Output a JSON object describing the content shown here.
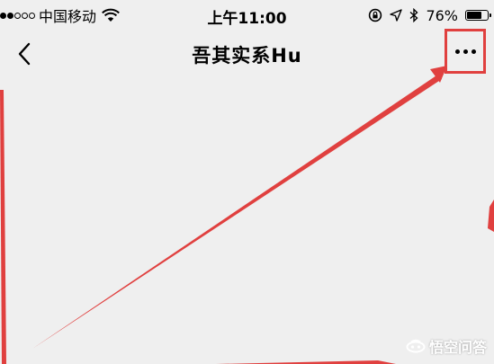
{
  "status_bar": {
    "carrier": "中国移动",
    "time": "上午11:00",
    "battery_percent": "76%",
    "battery_level": 0.76,
    "icons": [
      "signal-dots-icon",
      "wifi-icon",
      "rotation-lock-icon",
      "location-arrow-icon",
      "bluetooth-icon",
      "battery-icon"
    ]
  },
  "nav": {
    "title": "吾其实系Hu",
    "back_icon": "chevron-left-icon",
    "more_icon": "more-dots-icon"
  },
  "annotation": {
    "highlight_color": "#e0403f"
  },
  "watermark": {
    "text": "悟空问答"
  }
}
